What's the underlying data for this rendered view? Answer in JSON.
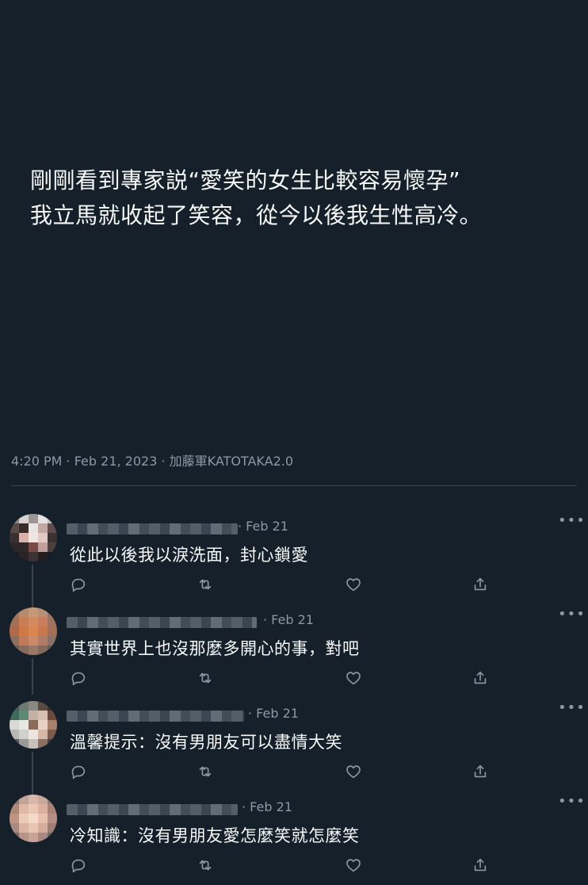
{
  "tweet": {
    "lines": [
      "剛剛看到專家説“愛笑的女生比較容易懷孕”",
      "我立馬就收起了笑容，從今以後我生性高冷。"
    ],
    "meta": "4:20 PM · Feb 21, 2023 · 加藤軍KATOTAKA2.0"
  },
  "replies": [
    {
      "date": "· Feb 21",
      "text": "從此以後我以淚洗面，封心鎖愛"
    },
    {
      "date": "· Feb 21",
      "text": "其實世界上也沒那麼多開心的事，對吧"
    },
    {
      "date": "· Feb 21",
      "text": "溫馨提示：沒有男朋友可以盡情大笑"
    },
    {
      "date": "· Feb 21",
      "text": "冷知識：沒有男朋友愛怎麼笑就怎麼笑"
    }
  ],
  "icons": {
    "reply": "reply-icon",
    "retweet": "retweet-icon",
    "like": "heart-icon",
    "share": "share-icon",
    "more": "more-icon"
  },
  "colors": {
    "background": "#15202b",
    "text": "#f7f9f9",
    "secondary": "#8b98a5",
    "divider": "#38444d"
  }
}
